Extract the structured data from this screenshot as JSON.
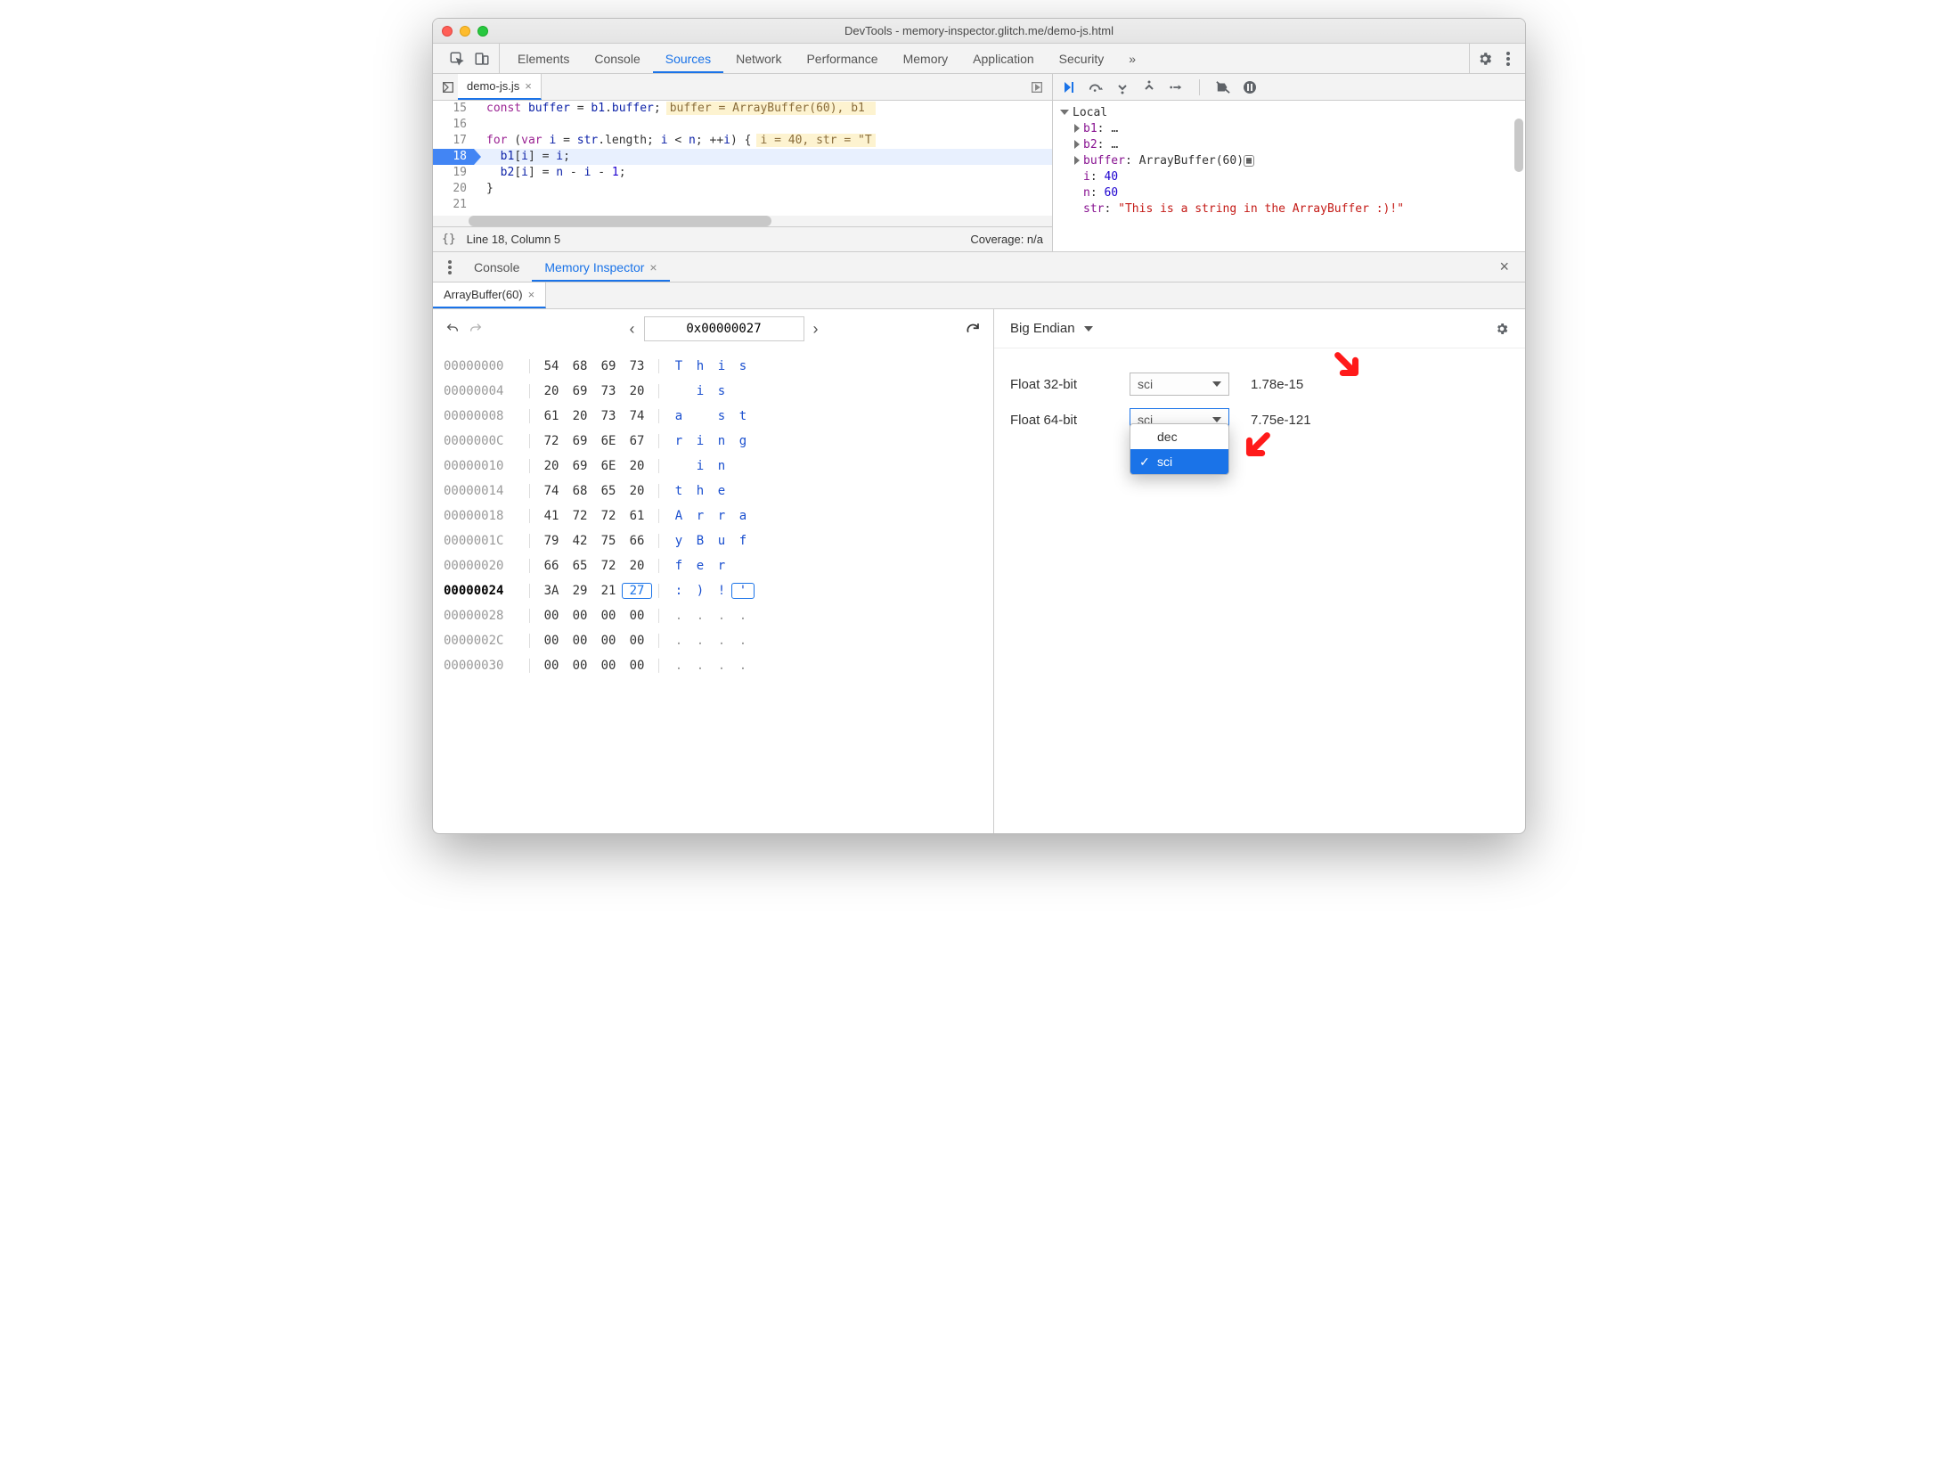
{
  "window": {
    "title": "DevTools - memory-inspector.glitch.me/demo-js.html"
  },
  "tabs": {
    "items": [
      "Elements",
      "Console",
      "Sources",
      "Network",
      "Performance",
      "Memory",
      "Application",
      "Security"
    ],
    "more": "»",
    "active_index": 2
  },
  "sources": {
    "filename": "demo-js.js",
    "lines": [
      {
        "n": 15,
        "code": "const buffer = b1.buffer;",
        "inline": "buffer = ArrayBuffer(60), b1 "
      },
      {
        "n": 16,
        "code": ""
      },
      {
        "n": 17,
        "code": "for (var i = str.length; i < n; ++i) {",
        "inline": "i = 40, str = \"T"
      },
      {
        "n": 18,
        "code": "  b1[i] = i;",
        "bp": true,
        "hl": true
      },
      {
        "n": 19,
        "code": "  b2[i] = n - i - 1;"
      },
      {
        "n": 20,
        "code": "}"
      },
      {
        "n": 21,
        "code": ""
      }
    ],
    "status_left": "Line 18, Column 5",
    "status_right": "Coverage: n/a"
  },
  "scope": {
    "header": "Local",
    "rows": [
      {
        "k": "b1",
        "v": "…",
        "expand": true
      },
      {
        "k": "b2",
        "v": "…",
        "expand": true
      },
      {
        "k": "buffer",
        "v": "ArrayBuffer(60)",
        "expand": true,
        "icon": true
      },
      {
        "k": "i",
        "v": "40",
        "num": true
      },
      {
        "k": "n",
        "v": "60",
        "num": true
      },
      {
        "k": "str",
        "v": "\"This is a string in the ArrayBuffer :)!\"",
        "str": true
      }
    ]
  },
  "drawer": {
    "tabs": [
      "Console",
      "Memory Inspector"
    ],
    "active_index": 1,
    "buffer_tab": "ArrayBuffer(60)"
  },
  "mi": {
    "address": "0x00000027",
    "rows": [
      {
        "a": "00000000",
        "b": [
          "54",
          "68",
          "69",
          "73"
        ],
        "c": [
          "T",
          "h",
          "i",
          "s"
        ]
      },
      {
        "a": "00000004",
        "b": [
          "20",
          "69",
          "73",
          "20"
        ],
        "c": [
          " ",
          "i",
          "s",
          " "
        ]
      },
      {
        "a": "00000008",
        "b": [
          "61",
          "20",
          "73",
          "74"
        ],
        "c": [
          "a",
          " ",
          "s",
          "t"
        ]
      },
      {
        "a": "0000000C",
        "b": [
          "72",
          "69",
          "6E",
          "67"
        ],
        "c": [
          "r",
          "i",
          "n",
          "g"
        ]
      },
      {
        "a": "00000010",
        "b": [
          "20",
          "69",
          "6E",
          "20"
        ],
        "c": [
          " ",
          "i",
          "n",
          " "
        ]
      },
      {
        "a": "00000014",
        "b": [
          "74",
          "68",
          "65",
          "20"
        ],
        "c": [
          "t",
          "h",
          "e",
          " "
        ]
      },
      {
        "a": "00000018",
        "b": [
          "41",
          "72",
          "72",
          "61"
        ],
        "c": [
          "A",
          "r",
          "r",
          "a"
        ]
      },
      {
        "a": "0000001C",
        "b": [
          "79",
          "42",
          "75",
          "66"
        ],
        "c": [
          "y",
          "B",
          "u",
          "f"
        ]
      },
      {
        "a": "00000020",
        "b": [
          "66",
          "65",
          "72",
          "20"
        ],
        "c": [
          "f",
          "e",
          "r",
          " "
        ]
      },
      {
        "a": "00000024",
        "b": [
          "3A",
          "29",
          "21",
          "27"
        ],
        "c": [
          ":",
          ")",
          "!",
          "'"
        ],
        "cur": true,
        "sel": 3
      },
      {
        "a": "00000028",
        "b": [
          "00",
          "00",
          "00",
          "00"
        ],
        "c": [
          ".",
          ".",
          ".",
          "."
        ]
      },
      {
        "a": "0000002C",
        "b": [
          "00",
          "00",
          "00",
          "00"
        ],
        "c": [
          ".",
          ".",
          ".",
          "."
        ]
      },
      {
        "a": "00000030",
        "b": [
          "00",
          "00",
          "00",
          "00"
        ],
        "c": [
          ".",
          ".",
          ".",
          "."
        ]
      }
    ],
    "endian": "Big Endian",
    "float32": {
      "label": "Float 32-bit",
      "mode": "sci",
      "value": "1.78e-15"
    },
    "float64": {
      "label": "Float 64-bit",
      "mode": "sci",
      "value": "7.75e-121"
    },
    "dropdown": {
      "opts": [
        "dec",
        "sci"
      ],
      "selected": "sci"
    }
  }
}
